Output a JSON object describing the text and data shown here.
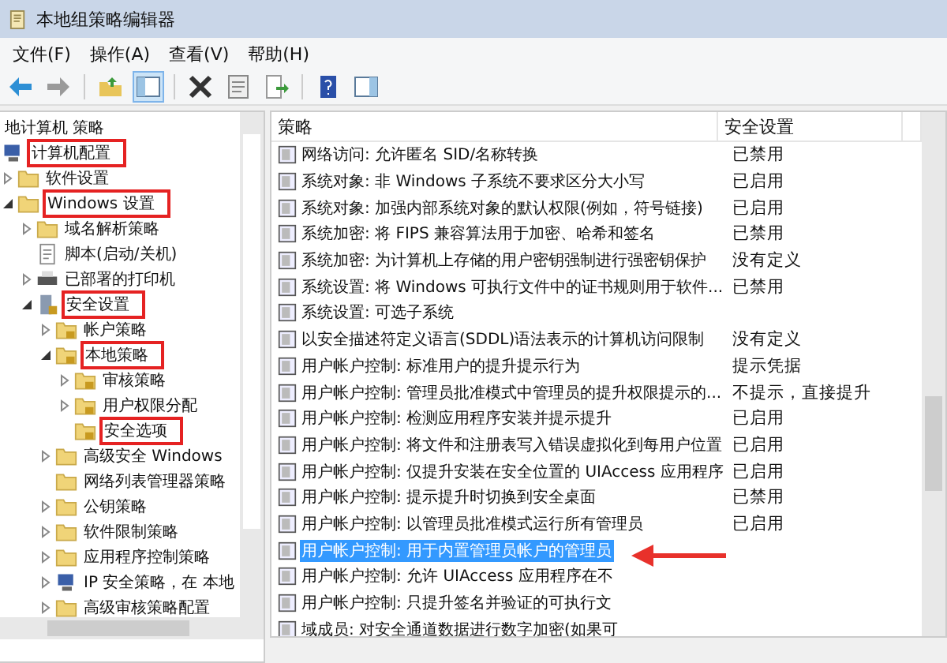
{
  "window": {
    "title": "本地组策略编辑器"
  },
  "menu": [
    "文件(F)",
    "操作(A)",
    "查看(V)",
    "帮助(H)"
  ],
  "toolbar": [
    {
      "kind": "back"
    },
    {
      "kind": "forward"
    },
    {
      "kind": "sep"
    },
    {
      "kind": "up-folder"
    },
    {
      "kind": "show-tree",
      "selected": true
    },
    {
      "kind": "sep"
    },
    {
      "kind": "delete"
    },
    {
      "kind": "properties"
    },
    {
      "kind": "export"
    },
    {
      "kind": "sep"
    },
    {
      "kind": "help"
    },
    {
      "kind": "show-pane",
      "selected": false
    }
  ],
  "tree": {
    "label": "地计算机 策略",
    "children": [
      {
        "label": "计算机配置",
        "kind": "computer",
        "outlined": true,
        "children": [
          {
            "label": "软件设置",
            "kind": "folder",
            "expanded": false,
            "outlined": false
          },
          {
            "label": "Windows 设置",
            "kind": "folder",
            "expanded": true,
            "outlined": true,
            "children": [
              {
                "label": "域名解析策略",
                "kind": "folder",
                "expanded": false,
                "outlined": false
              },
              {
                "label": "脚本(启动/关机)",
                "kind": "script",
                "outlined": false
              },
              {
                "label": "已部署的打印机",
                "kind": "printer",
                "expanded": false,
                "outlined": false
              },
              {
                "label": "安全设置",
                "kind": "security",
                "expanded": true,
                "outlined": true,
                "children": [
                  {
                    "label": "帐户策略",
                    "kind": "locked-folder",
                    "expanded": false,
                    "outlined": false
                  },
                  {
                    "label": "本地策略",
                    "kind": "locked-folder",
                    "expanded": true,
                    "outlined": true,
                    "children": [
                      {
                        "label": "审核策略",
                        "kind": "locked-folder",
                        "expanded": false,
                        "outlined": false
                      },
                      {
                        "label": "用户权限分配",
                        "kind": "locked-folder",
                        "expanded": false,
                        "outlined": false
                      },
                      {
                        "label": "安全选项",
                        "kind": "locked-folder",
                        "outlined": true
                      }
                    ]
                  },
                  {
                    "label": "高级安全 Windows",
                    "kind": "folder",
                    "expanded": false,
                    "outlined": false
                  },
                  {
                    "label": "网络列表管理器策略",
                    "kind": "folder",
                    "outlined": false
                  },
                  {
                    "label": "公钥策略",
                    "kind": "folder",
                    "expanded": false,
                    "outlined": false
                  },
                  {
                    "label": "软件限制策略",
                    "kind": "folder",
                    "expanded": false,
                    "outlined": false
                  },
                  {
                    "label": "应用程序控制策略",
                    "kind": "folder",
                    "expanded": false,
                    "outlined": false
                  },
                  {
                    "label": "IP 安全策略，在 本地",
                    "kind": "computer",
                    "expanded": false,
                    "outlined": false
                  },
                  {
                    "label": "高级审核策略配置",
                    "kind": "folder",
                    "expanded": false,
                    "outlined": false
                  }
                ]
              }
            ]
          }
        ]
      }
    ]
  },
  "table": {
    "columns": [
      "策略",
      "安全设置"
    ],
    "rows": [
      {
        "policy": "网络访问: 允许匿名 SID/名称转换",
        "setting": "已禁用",
        "selected": false
      },
      {
        "policy": "系统对象: 非 Windows 子系统不要求区分大小写",
        "setting": "已启用",
        "selected": false
      },
      {
        "policy": "系统对象: 加强内部系统对象的默认权限(例如，符号链接)",
        "setting": "已启用",
        "selected": false
      },
      {
        "policy": "系统加密: 将 FIPS 兼容算法用于加密、哈希和签名",
        "setting": "已禁用",
        "selected": false
      },
      {
        "policy": "系统加密: 为计算机上存储的用户密钥强制进行强密钥保护",
        "setting": "没有定义",
        "selected": false
      },
      {
        "policy": "系统设置: 将 Windows 可执行文件中的证书规则用于软件...",
        "setting": "已禁用",
        "selected": false
      },
      {
        "policy": "系统设置: 可选子系统",
        "selected": false
      },
      {
        "policy": "以安全描述符定义语言(SDDL)语法表示的计算机访问限制",
        "setting": "没有定义",
        "selected": false
      },
      {
        "policy": "用户帐户控制: 标准用户的提升提示行为",
        "setting": "提示凭据",
        "selected": false
      },
      {
        "policy": "用户帐户控制: 管理员批准模式中管理员的提升权限提示的...",
        "setting": "不提示，直接提升",
        "selected": false
      },
      {
        "policy": "用户帐户控制: 检测应用程序安装并提示提升",
        "setting": "已启用",
        "selected": false
      },
      {
        "policy": "用户帐户控制: 将文件和注册表写入错误虚拟化到每用户位置",
        "setting": "已启用",
        "selected": false
      },
      {
        "policy": "用户帐户控制: 仅提升安装在安全位置的 UIAccess 应用程序",
        "setting": "已启用",
        "selected": false
      },
      {
        "policy": "用户帐户控制: 提示提升时切换到安全桌面",
        "setting": "已禁用",
        "selected": false
      },
      {
        "policy": "用户帐户控制: 以管理员批准模式运行所有管理员",
        "setting": "已启用",
        "selected": false
      },
      {
        "policy": "用户帐户控制: 用于内置管理员帐户的管理员",
        "selected": true
      },
      {
        "policy": "用户帐户控制: 允许 UIAccess 应用程序在不",
        "selected": false
      },
      {
        "policy": "用户帐户控制: 只提升签名并验证的可执行文",
        "selected": false
      },
      {
        "policy": "域成员: 对安全通道数据进行数字加密(如果可",
        "selected": false
      }
    ]
  },
  "annotation": {
    "kind": "arrow"
  }
}
